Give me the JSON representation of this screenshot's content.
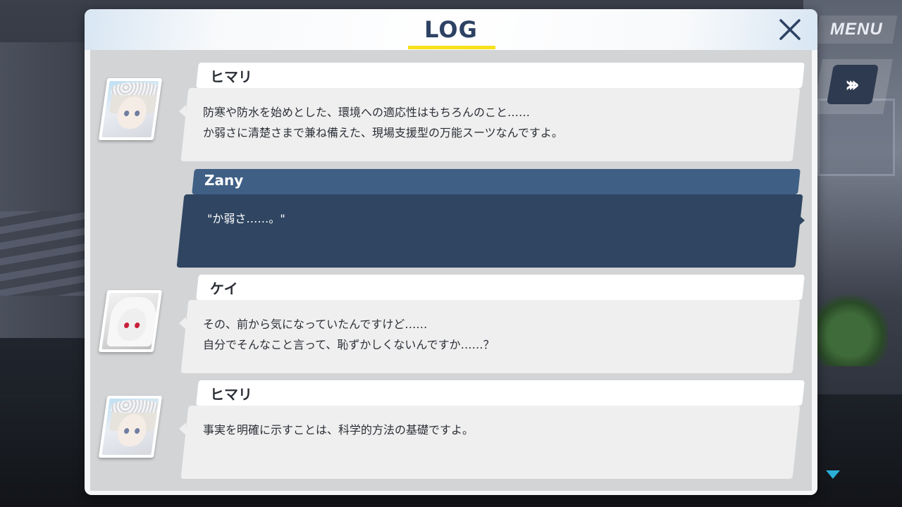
{
  "panel": {
    "title": "LOG",
    "close_icon": "close-icon"
  },
  "controls": {
    "menu_label": "MENU",
    "fast_forward_icon": "fast-forward-icon"
  },
  "colors": {
    "title": "#2d4263",
    "underline": "#f6e11c",
    "player_name_bar": "#3f5f85",
    "player_message": "#2f4561"
  },
  "log": [
    {
      "speaker": "ヒマリ",
      "avatar": "himari-portrait",
      "lines": "防寒や防水を始めとした、環境への適応性はもちろんのこと……\nか弱さに清楚さまで兼ね備えた、現場支援型の万能スーツなんですよ。"
    },
    {
      "speaker": "Zany",
      "is_player": true,
      "lines": "\"か弱さ……。\""
    },
    {
      "speaker": "ケイ",
      "avatar": "kei-portrait",
      "lines": "その、前から気になっていたんですけど……\n自分でそんなこと言って、恥ずかしくないんですか……？"
    },
    {
      "speaker": "ヒマリ",
      "avatar": "himari-portrait",
      "lines": "事実を明確に示すことは、科学的方法の基礎ですよ。"
    }
  ]
}
